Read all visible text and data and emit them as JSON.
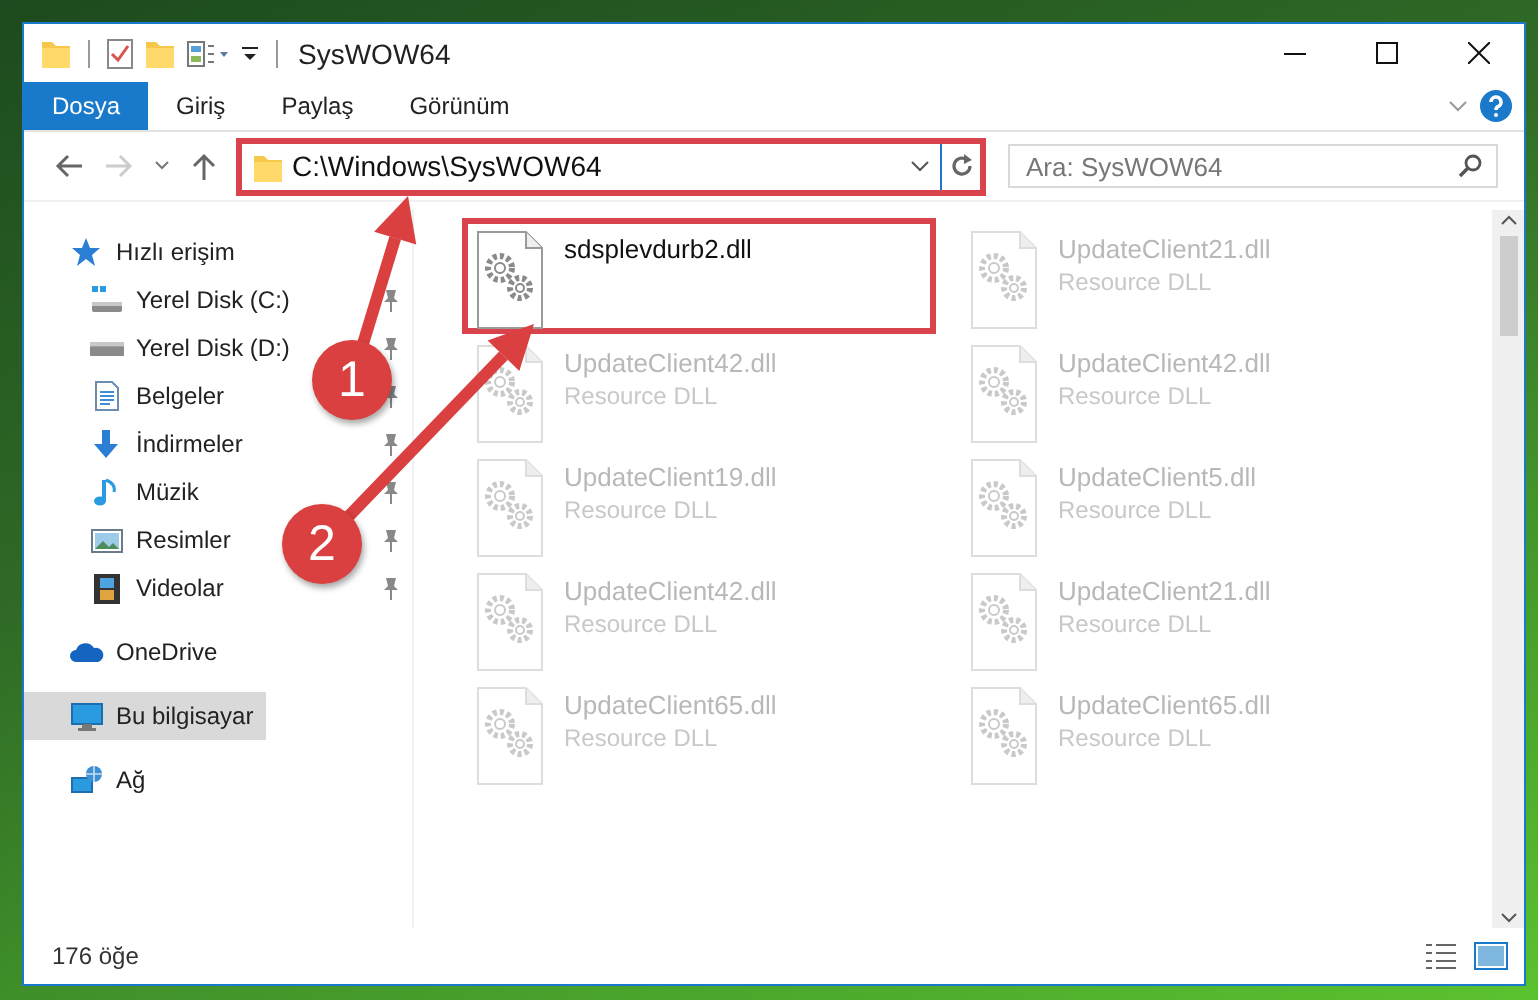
{
  "window": {
    "title": "SysWOW64"
  },
  "ribbon_tabs": [
    {
      "label": "Dosya",
      "selected": true
    },
    {
      "label": "Giriş",
      "selected": false
    },
    {
      "label": "Paylaş",
      "selected": false
    },
    {
      "label": "Görünüm",
      "selected": false
    }
  ],
  "address": {
    "value": "C:\\Windows\\SysWOW64",
    "highlighted": true
  },
  "search": {
    "placeholder": "Ara: SysWOW64"
  },
  "sidebar": {
    "items": [
      {
        "label": "Hızlı erişim",
        "kind": "star",
        "selected": false,
        "children": [
          {
            "label": "Yerel Disk (C:)",
            "kind": "system-drive",
            "selected": false,
            "pinned": true
          },
          {
            "label": "Yerel Disk (D:)",
            "kind": "drive",
            "selected": false,
            "pinned": true
          },
          {
            "label": "Belgeler",
            "kind": "documents",
            "selected": false,
            "pinned": true
          },
          {
            "label": "İndirmeler",
            "kind": "downloads",
            "selected": false,
            "pinned": true
          },
          {
            "label": "Müzik",
            "kind": "music",
            "selected": false,
            "pinned": true
          },
          {
            "label": "Resimler",
            "kind": "pictures",
            "selected": false,
            "pinned": true
          },
          {
            "label": "Videolar",
            "kind": "videos",
            "selected": false,
            "pinned": true
          }
        ]
      },
      {
        "label": "OneDrive",
        "kind": "cloud",
        "selected": false
      },
      {
        "label": "Bu bilgisayar",
        "kind": "computer",
        "selected": true
      },
      {
        "label": "Ağ",
        "kind": "network",
        "selected": false
      }
    ]
  },
  "files": [
    {
      "name": "sdsplevdurb2.dll",
      "highlighted": true,
      "dimmed": false
    },
    {
      "name": "UpdateClient21.dll",
      "type": "Resource DLL",
      "highlighted": false,
      "dimmed": true
    },
    {
      "name": "UpdateClient42.dll",
      "type": "Resource DLL",
      "highlighted": false,
      "dimmed": true
    },
    {
      "name": "UpdateClient42.dll",
      "type": "Resource DLL",
      "highlighted": false,
      "dimmed": true
    },
    {
      "name": "UpdateClient19.dll",
      "type": "Resource DLL",
      "highlighted": false,
      "dimmed": true
    },
    {
      "name": "UpdateClient5.dll",
      "type": "Resource DLL",
      "highlighted": false,
      "dimmed": true
    },
    {
      "name": "UpdateClient42.dll",
      "type": "Resource DLL",
      "highlighted": false,
      "dimmed": true
    },
    {
      "name": "UpdateClient21.dll",
      "type": "Resource DLL",
      "highlighted": false,
      "dimmed": true
    },
    {
      "name": "UpdateClient65.dll",
      "type": "Resource DLL",
      "highlighted": false,
      "dimmed": true
    },
    {
      "name": "UpdateClient65.dll",
      "type": "Resource DLL",
      "highlighted": false,
      "dimmed": true
    }
  ],
  "status_bar": {
    "item_count": "176 öğe"
  },
  "annotations": [
    {
      "label": "1"
    },
    {
      "label": "2"
    }
  ]
}
